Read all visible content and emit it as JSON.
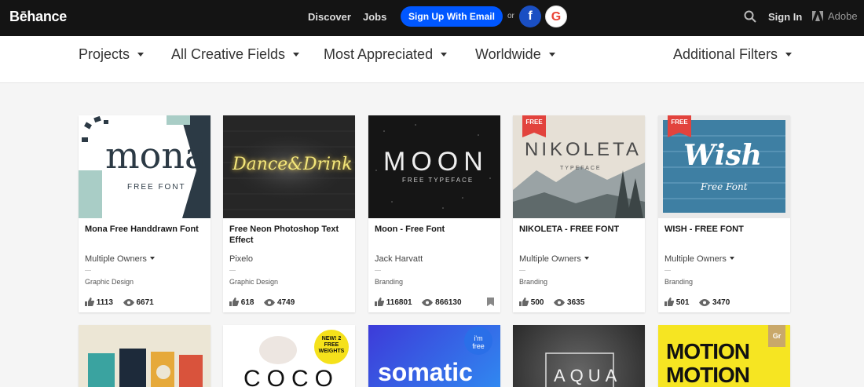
{
  "header": {
    "logo": "Bēhance",
    "nav": [
      "Discover",
      "Jobs"
    ],
    "signup_label": "Sign Up With Email",
    "or_label": "or",
    "facebook_label": "f",
    "google_label": "G",
    "signin_label": "Sign In",
    "adobe_label": "Adobe"
  },
  "filters": {
    "type": "Projects",
    "fields": "All Creative Fields",
    "sort": "Most Appreciated",
    "location": "Worldwide",
    "additional": "Additional Filters"
  },
  "projects": [
    {
      "title": "Mona Free Handdrawn Font",
      "owner": "Multiple Owners",
      "field": "Graphic Design",
      "likes": "1113",
      "views": "6671",
      "thumb_title": "mona",
      "thumb_sub": "FREE FONT"
    },
    {
      "title": "Free Neon Photoshop Text Effect",
      "owner": "Pixelo",
      "field": "Graphic Design",
      "likes": "618",
      "views": "4749",
      "thumb_title": "Dance&Drink"
    },
    {
      "title": "Moon - Free Font",
      "owner": "Jack Harvatt",
      "field": "Branding",
      "likes": "116801",
      "views": "866130",
      "thumb_title": "MOON",
      "thumb_sub": "FREE TYPEFACE"
    },
    {
      "title": "NIKOLETA - FREE FONT",
      "owner": "Multiple Owners",
      "field": "Branding",
      "likes": "500",
      "views": "3635",
      "thumb_title": "NIKOLETA",
      "thumb_sub": "TYPEFACE",
      "badge": "FREE"
    },
    {
      "title": "WISH - FREE FONT",
      "owner": "Multiple Owners",
      "field": "Branding",
      "likes": "501",
      "views": "3470",
      "thumb_title": "Wish",
      "thumb_sub": "Free Font",
      "badge": "FREE"
    }
  ],
  "bottom_projects": [
    {
      "thumb_title": ""
    },
    {
      "thumb_title": "COCO",
      "badge": "NEW! 2 FREE WEIGHTS"
    },
    {
      "thumb_title": "somatic",
      "badge": "i'm free"
    },
    {
      "thumb_title": "AQUA"
    },
    {
      "thumb_title": "MOTION",
      "thumb_sub": "MOTION",
      "badge": "Gr"
    }
  ],
  "colors": {
    "topbar": "#141414",
    "signup": "#0057ff",
    "facebook": "#1a4fc3",
    "free_badge": "#e2433d"
  }
}
